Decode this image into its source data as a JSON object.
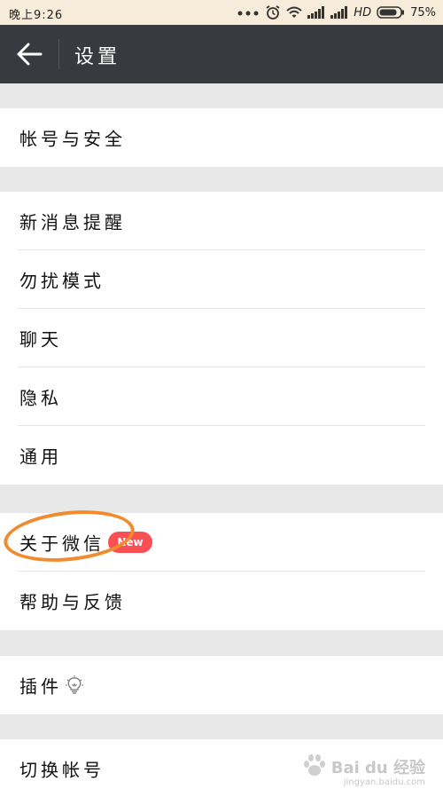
{
  "status": {
    "time": "晚上9:26",
    "network": "HD",
    "battery": "75%"
  },
  "header": {
    "title": "设置"
  },
  "groups": {
    "account": {
      "label": "帐号与安全"
    },
    "general": {
      "items": [
        "新消息提醒",
        "勿扰模式",
        "聊天",
        "隐私",
        "通用"
      ]
    },
    "about": {
      "about_label": "关于微信",
      "badge": "New",
      "help_label": "帮助与反馈"
    },
    "plugins": {
      "label": "插件"
    },
    "switch": {
      "label": "切换帐号"
    }
  },
  "watermark": {
    "text": "Bai du 经验",
    "url": "jingyan.baidu.com"
  },
  "colors": {
    "header_bg": "#393a3f",
    "badge": "#fa4f53",
    "highlight": "#f28a2e"
  }
}
